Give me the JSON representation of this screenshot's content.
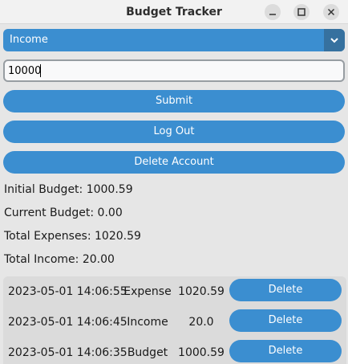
{
  "window": {
    "title": "Budget Tracker"
  },
  "form": {
    "type_selected": "Income",
    "amount_value": "10000",
    "submit_label": "Submit",
    "logout_label": "Log Out",
    "delete_account_label": "Delete Account"
  },
  "stats": {
    "initial": "Initial Budget: 1000.59",
    "current": "Current Budget: 0.00",
    "expenses": "Total Expenses: 1020.59",
    "income": "Total Income: 20.00"
  },
  "transactions": [
    {
      "date": "2023-05-01 14:06:55",
      "type": "Expense",
      "amount": "1020.59",
      "delete_label": "Delete"
    },
    {
      "date": "2023-05-01 14:06:45",
      "type": "Income",
      "amount": "20.0",
      "delete_label": "Delete"
    },
    {
      "date": "2023-05-01 14:06:35",
      "type": "Budget",
      "amount": "1000.59",
      "delete_label": "Delete"
    }
  ],
  "colors": {
    "accent": "#3b8ed0",
    "accent_dark": "#36719f",
    "background": "#e6e6e6"
  },
  "icons": {
    "minimize": "minimize-icon",
    "maximize": "maximize-icon",
    "close": "close-icon",
    "dropdown": "chevron-down-icon"
  }
}
